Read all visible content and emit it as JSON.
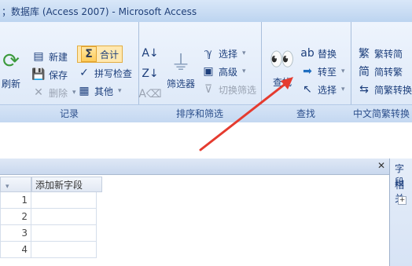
{
  "title": "；数据库 (Access 2007) - Microsoft Access",
  "ribbon": {
    "groups": {
      "records": {
        "label": "记录",
        "buttons": {
          "refresh_label": "刷新",
          "new_label": "新建",
          "save_label": "保存",
          "delete_label": "删除",
          "totals_label": "合计",
          "spelling_label": "拼写检查",
          "more_label": "其他"
        }
      },
      "sort_filter": {
        "label": "排序和筛选",
        "buttons": {
          "filter_label": "筛选器",
          "selection_label": "选择",
          "advanced_label": "高级",
          "toggle_filter_label": "切换筛选"
        }
      },
      "find": {
        "label": "查找",
        "buttons": {
          "find_label": "查找",
          "replace_label": "替换",
          "goto_label": "转至",
          "select_label": "选择"
        }
      },
      "chinese_conversion": {
        "label": "中文简繁转换",
        "buttons": {
          "to_simplified_label": "繁转简",
          "to_traditional_label": "简转繁",
          "conversion_label": "简繁转换"
        }
      }
    }
  },
  "table": {
    "add_field_label": "添加新字段",
    "row_numbers": [
      "1",
      "2",
      "3",
      "4"
    ]
  },
  "right_panel": {
    "title": "字段",
    "subtitle": "相关"
  },
  "colors": {
    "ribbon_bg": "#dbe7f7",
    "accent_red": "#e53b2f",
    "text_blue": "#1d3f7c"
  }
}
